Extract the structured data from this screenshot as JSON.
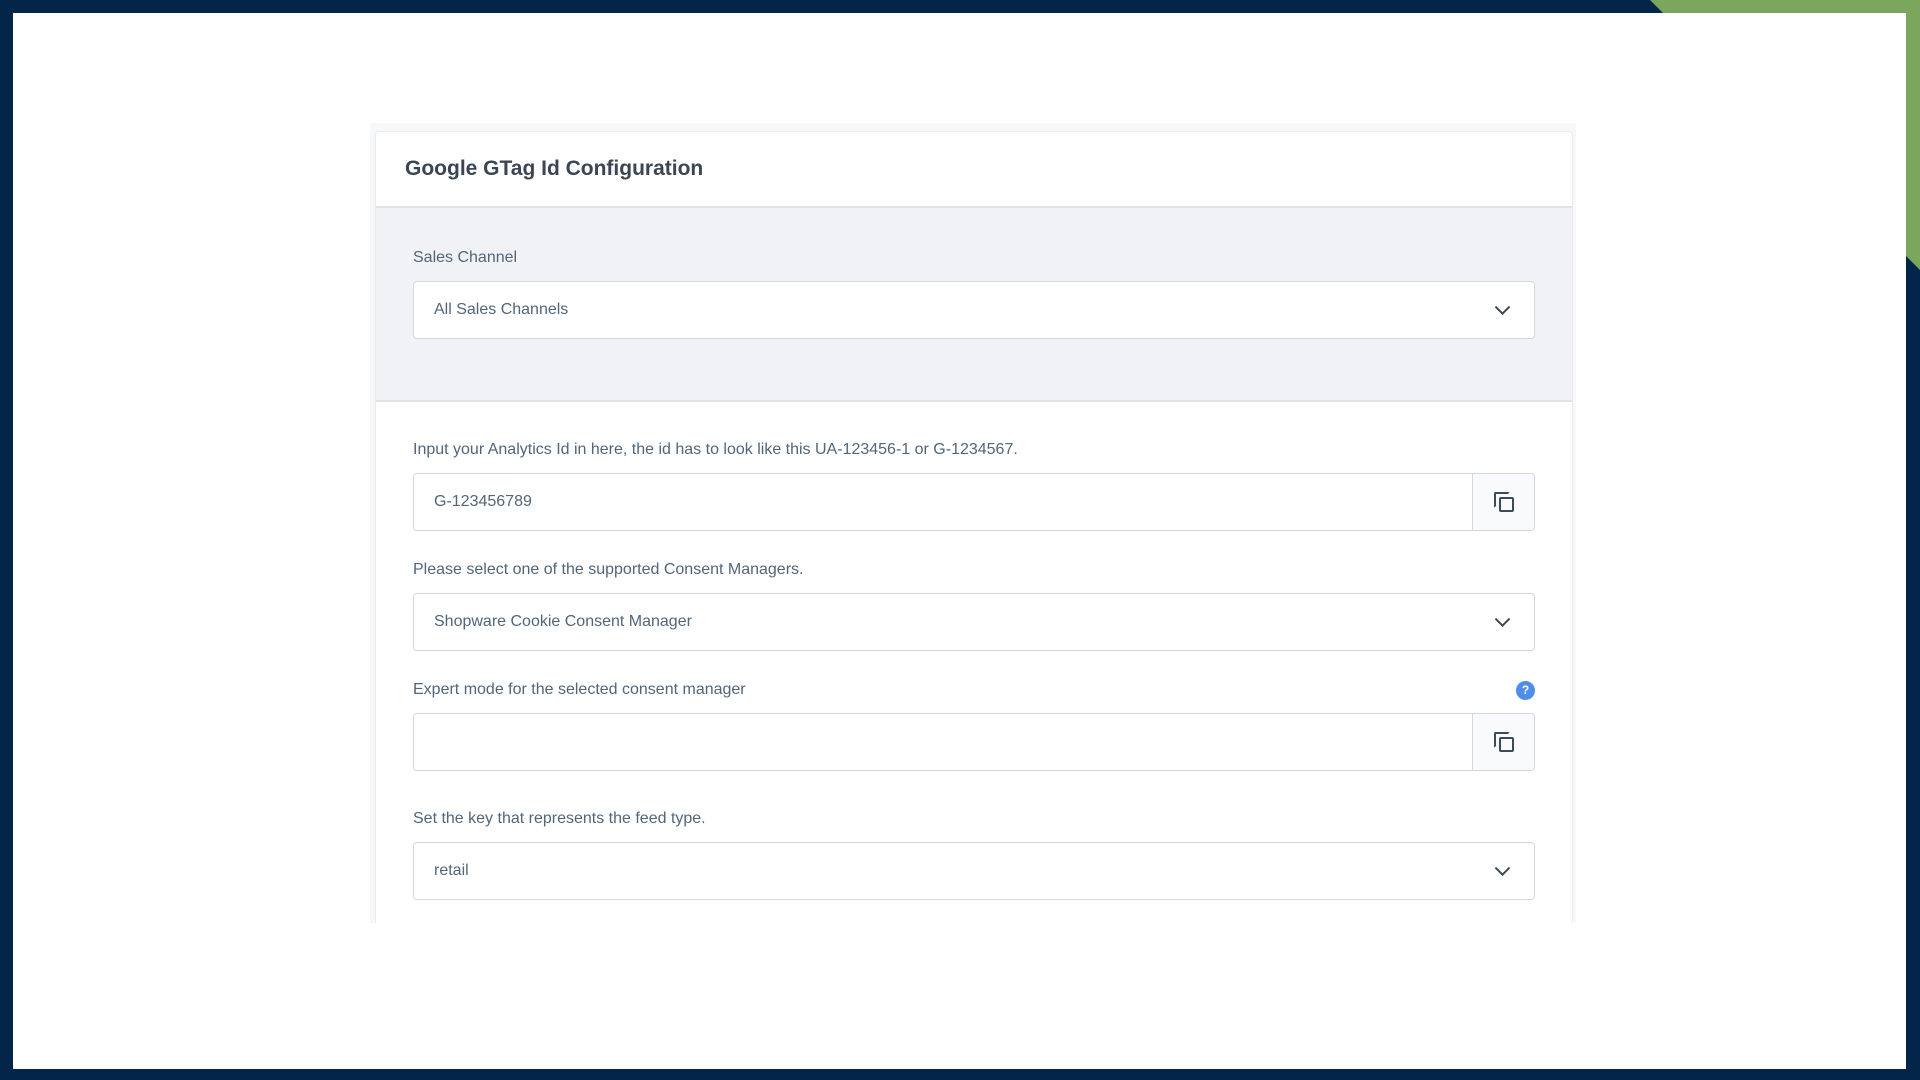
{
  "card": {
    "title": "Google GTag Id Configuration"
  },
  "sales_channel": {
    "label": "Sales Channel",
    "value": "All Sales Channels"
  },
  "analytics_id": {
    "label": "Input your Analytics Id in here, the id has to look like this UA-123456-1 or G-1234567.",
    "value": "G-123456789"
  },
  "consent_manager": {
    "label": "Please select one of the supported Consent Managers.",
    "value": "Shopware Cookie Consent Manager"
  },
  "expert_mode": {
    "label": "Expert mode for the selected consent manager",
    "value": "",
    "help_glyph": "?"
  },
  "feed_type": {
    "label": "Set the key that represents the feed type.",
    "value": "retail"
  },
  "icons": {
    "copy": "copy-icon",
    "chevron": "chevron-down-icon",
    "help": "help-icon"
  },
  "colors": {
    "frame": "#03254a",
    "frame_accent": "#7aa65d",
    "help_icon": "#4f8ee6"
  }
}
